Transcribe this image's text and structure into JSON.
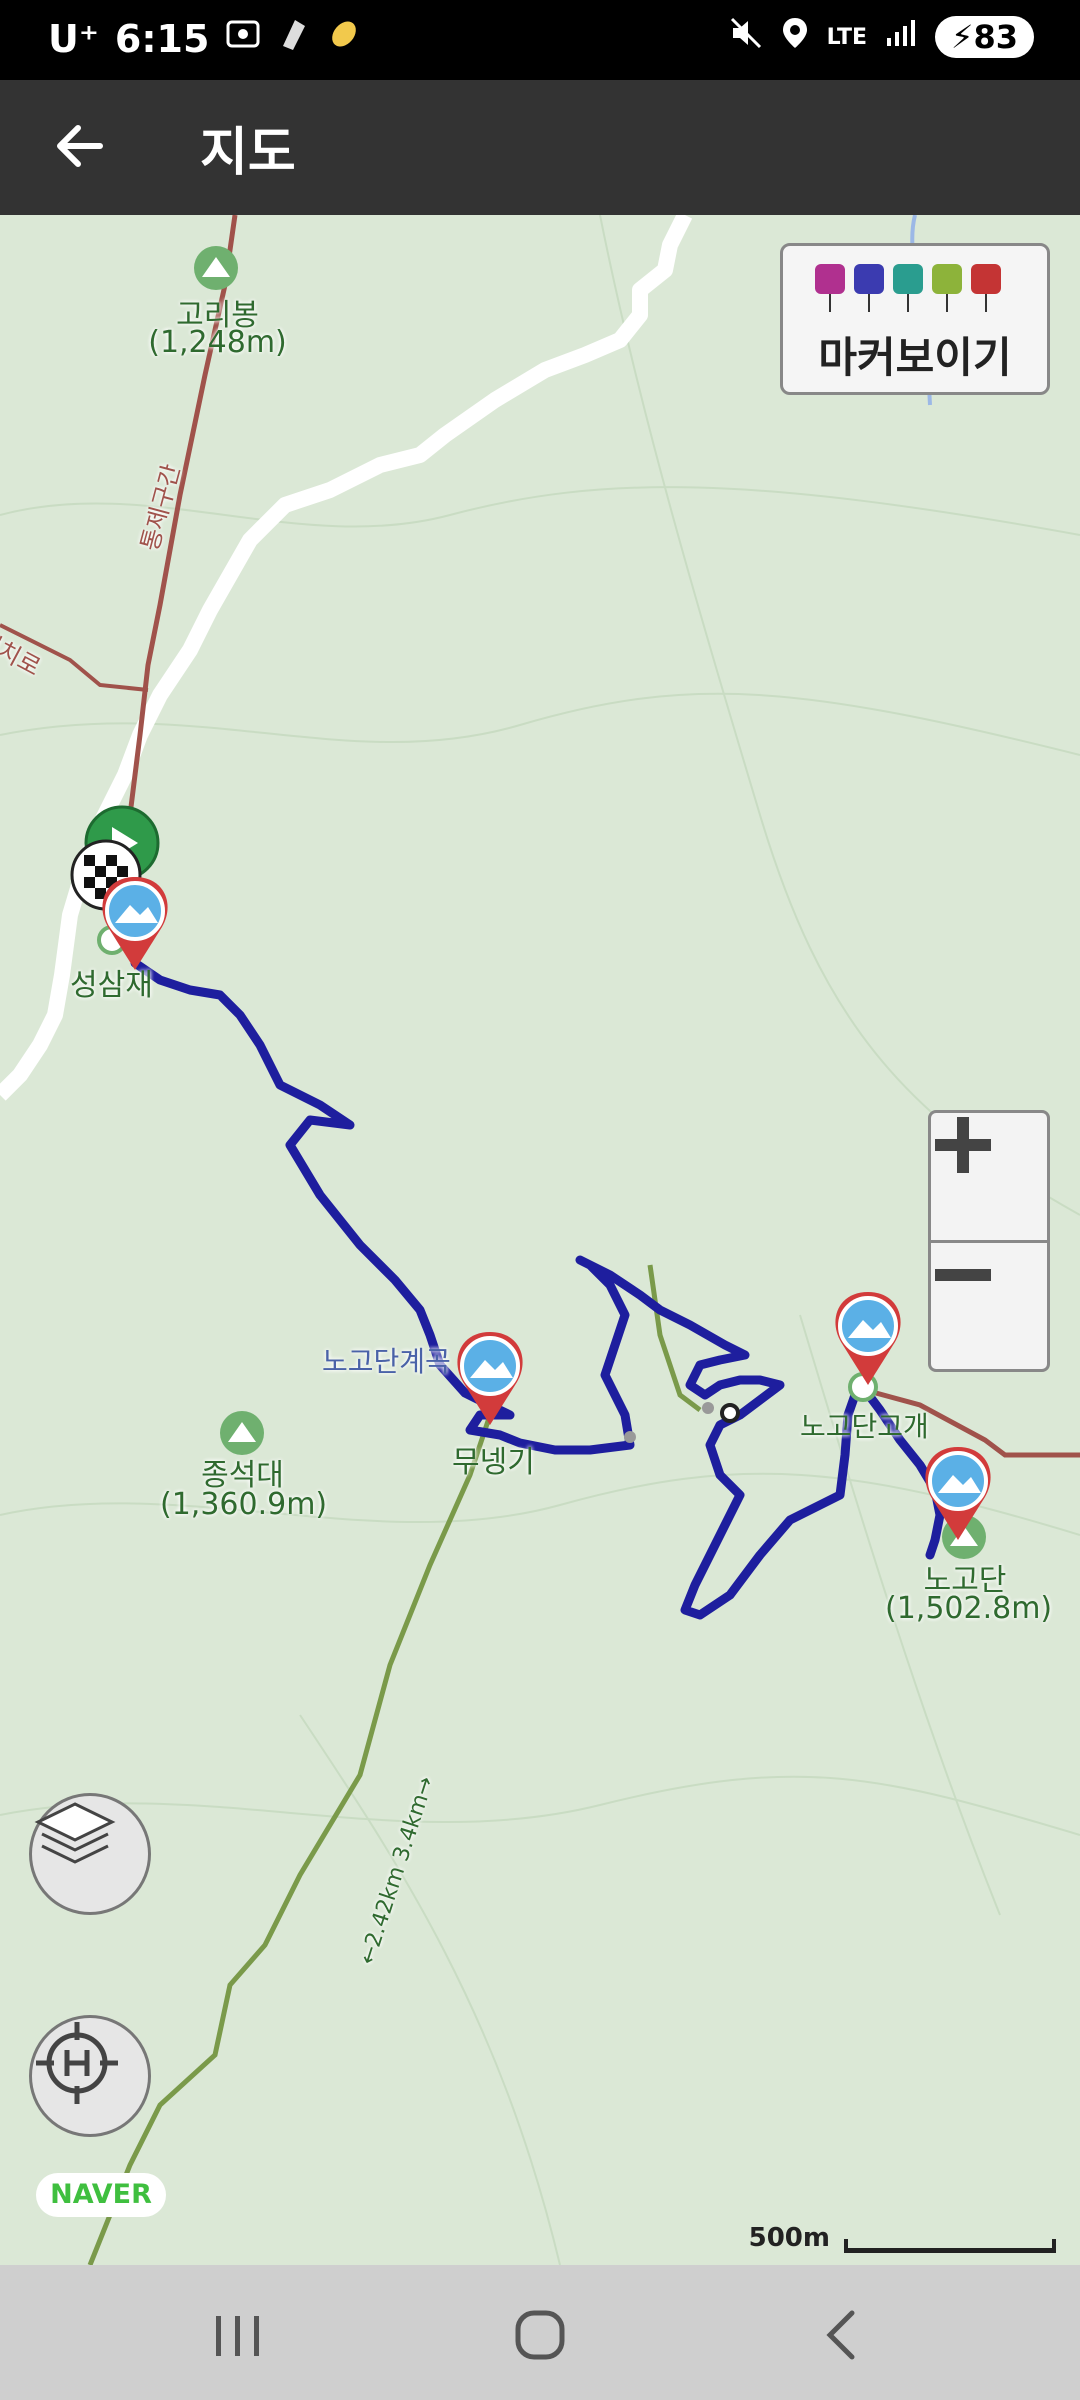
{
  "status_bar": {
    "carrier": "U⁺",
    "time": "6:15",
    "network": "LTE",
    "battery": "83",
    "icons": [
      "screenshot-icon",
      "app-notification-icon",
      "app-notification-icon",
      "mute-icon",
      "location-icon",
      "signal-icon"
    ]
  },
  "header": {
    "title": "지도",
    "back_icon": "arrow-left-icon"
  },
  "marker_panel": {
    "label": "마커보이기",
    "icon_colors": [
      "#b0308f",
      "#3b3bb0",
      "#2a9d8f",
      "#8db33a",
      "#c43434"
    ]
  },
  "map": {
    "labels": {
      "goribong": "고리봉",
      "goribong_elev": "(1,248m)",
      "tongje": "통제구간",
      "jeongnyeong": "정령치로",
      "seongsamjae": "성삼재",
      "nogodan_valley": "노고단계곡",
      "munegi": "무넹기",
      "jongseokdae": "종석대",
      "jongseokdae_elev": "(1,360.9m)",
      "nogodan_pass": "노고단고개",
      "nogodan": "노고단",
      "nogodan_elev": "(1,502.8m)",
      "trail_dist": "←2.42km 3.4km→"
    },
    "route_color": "#1e1e9e",
    "road_color": "#ffffff",
    "trail_color": "#a0524b"
  },
  "controls": {
    "zoom_in": "+",
    "zoom_out": "−",
    "layers_icon": "layers-icon",
    "locate_icon": "locate-crosshair-icon"
  },
  "brand": {
    "naver": "NAVER"
  },
  "scale": {
    "label": "500m"
  },
  "nav": {
    "recents_icon": "recents-icon",
    "home_icon": "home-icon",
    "back_icon": "nav-back-icon"
  }
}
